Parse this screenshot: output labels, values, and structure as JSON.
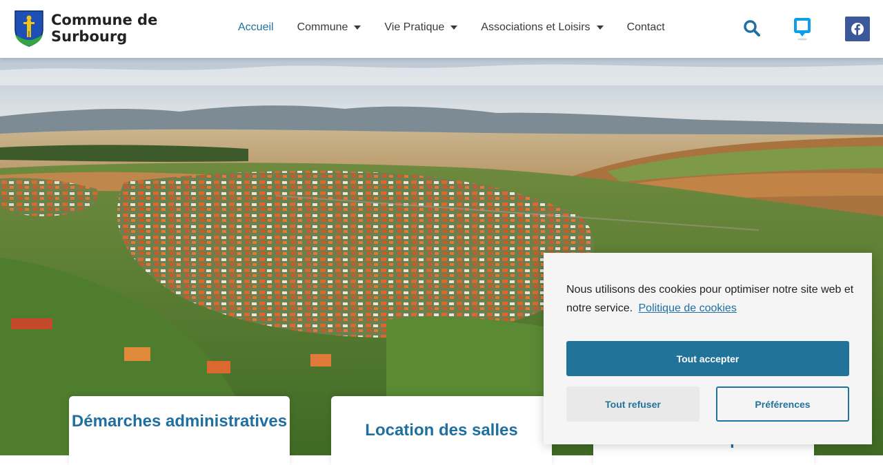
{
  "header": {
    "logo_line1": "Commune de",
    "logo_line2": "Surbourg",
    "crest_icon": "coat-of-arms-icon"
  },
  "nav": {
    "items": [
      {
        "label": "Accueil",
        "active": true,
        "has_dropdown": false
      },
      {
        "label": "Commune",
        "active": false,
        "has_dropdown": true
      },
      {
        "label": "Vie Pratique",
        "active": false,
        "has_dropdown": true
      },
      {
        "label": "Associations et Loisirs",
        "active": false,
        "has_dropdown": true
      },
      {
        "label": "Contact",
        "active": false,
        "has_dropdown": false
      }
    ]
  },
  "actions": {
    "search_icon": "search-icon",
    "notification_icon": "speech-bubble-icon",
    "facebook_icon": "facebook-icon"
  },
  "cards": [
    {
      "title": "Démarches administratives"
    },
    {
      "title": "Location des salles"
    },
    {
      "title": "Bibliothèque"
    }
  ],
  "cookie": {
    "message": "Nous utilisons des cookies pour optimiser notre site web et notre service.",
    "policy_link": "Politique de cookies",
    "accept_label": "Tout accepter",
    "refuse_label": "Tout refuser",
    "preferences_label": "Préférences"
  },
  "colors": {
    "accent": "#1f6fa0",
    "button": "#22739a",
    "facebook": "#3b5998"
  }
}
